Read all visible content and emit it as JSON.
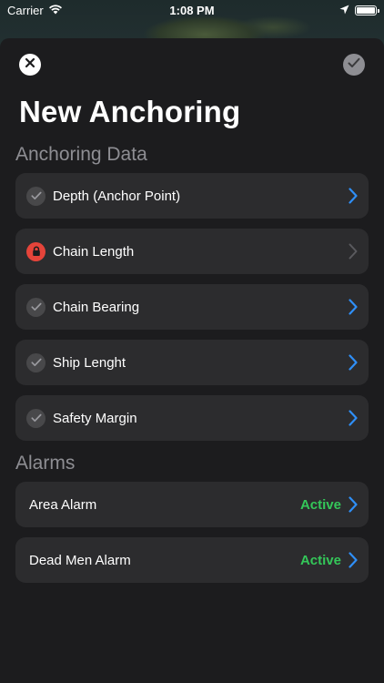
{
  "status_bar": {
    "carrier": "Carrier",
    "time": "1:08 PM"
  },
  "header": {
    "title": "New Anchoring"
  },
  "sections": {
    "anchoring": {
      "title": "Anchoring Data",
      "items": [
        {
          "label": "Depth (Anchor Point)",
          "icon": "check-icon",
          "enabled": true
        },
        {
          "label": "Chain Length",
          "icon": "lock-icon",
          "enabled": false
        },
        {
          "label": "Chain Bearing",
          "icon": "check-icon",
          "enabled": true
        },
        {
          "label": "Ship Lenght",
          "icon": "check-icon",
          "enabled": true
        },
        {
          "label": "Safety Margin",
          "icon": "check-icon",
          "enabled": true
        }
      ]
    },
    "alarms": {
      "title": "Alarms",
      "items": [
        {
          "label": "Area Alarm",
          "status": "Active"
        },
        {
          "label": "Dead Men Alarm",
          "status": "Active"
        }
      ]
    }
  },
  "colors": {
    "accent": "#2f8ff7",
    "active": "#34c759",
    "lock": "#e5443a",
    "row_bg": "#2c2c2e",
    "background": "#1c1c1e"
  }
}
